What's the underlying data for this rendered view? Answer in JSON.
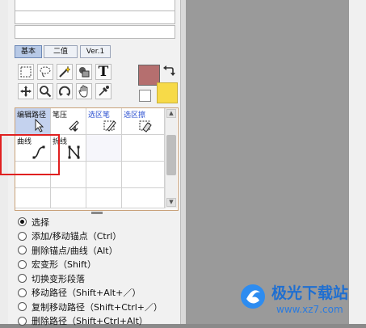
{
  "tabs": [
    {
      "label": "基本"
    },
    {
      "label": "二值"
    },
    {
      "label": "Ver.1"
    }
  ],
  "tools": [
    {
      "name": "rect-select-icon"
    },
    {
      "name": "lasso-icon"
    },
    {
      "name": "magic-wand-icon"
    },
    {
      "name": "fill-icon"
    },
    {
      "name": "text-icon",
      "glyph": "T"
    },
    {
      "name": "move-icon"
    },
    {
      "name": "zoom-icon"
    },
    {
      "name": "rotate-icon"
    },
    {
      "name": "hand-icon"
    },
    {
      "name": "eyedropper-icon"
    }
  ],
  "colors": {
    "primary": "#b56f6f",
    "secondary": "#f7da48",
    "highlight": "#e02020",
    "accent": "#2a4fd0"
  },
  "subtools": [
    {
      "label": "编辑路径",
      "blue": false
    },
    {
      "label": "笔压",
      "blue": false
    },
    {
      "label": "选区笔",
      "blue": true
    },
    {
      "label": "选区擦",
      "blue": true
    },
    {
      "label": "曲线",
      "blue": false
    },
    {
      "label": "折线",
      "blue": false
    }
  ],
  "options": [
    {
      "label": "选择",
      "checked": true
    },
    {
      "label": "添加/移动锚点（Ctrl）",
      "checked": false
    },
    {
      "label": "删除锚点/曲线（Alt）",
      "checked": false
    },
    {
      "label": "宏变形（Shift）",
      "checked": false
    },
    {
      "label": "切换变形段落",
      "checked": false
    },
    {
      "label": "移动路径（Shift+Alt+／）",
      "checked": false
    },
    {
      "label": "复制移动路径（Shift+Ctrl+／）",
      "checked": false
    },
    {
      "label": "删除路径（Shift+Ctrl+Alt）",
      "checked": false
    }
  ],
  "watermark": {
    "name": "极光下载站",
    "url": "www.xz7.com"
  }
}
